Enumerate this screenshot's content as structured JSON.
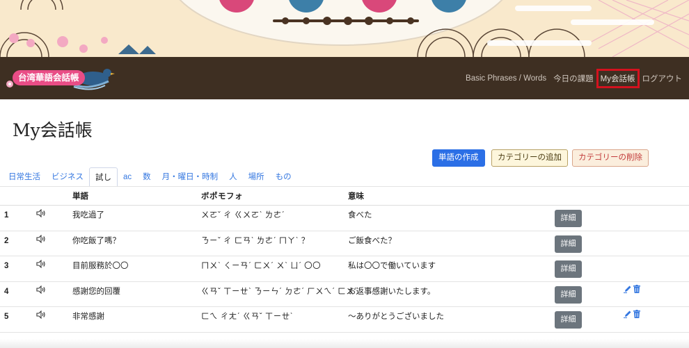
{
  "nav": {
    "logo_text": "台湾華語会話帳",
    "links": [
      {
        "label": "Basic Phrases / Words"
      },
      {
        "label": "今日の課題"
      },
      {
        "label": "My会話帳"
      },
      {
        "label": "ログアウト"
      }
    ]
  },
  "page": {
    "title": "My会話帳"
  },
  "actions": {
    "create_word": "単語の作成",
    "add_category": "カテゴリーの追加",
    "delete_category": "カテゴリーの削除"
  },
  "tabs": [
    {
      "label": "日常生活"
    },
    {
      "label": "ビジネス"
    },
    {
      "label": "試し"
    },
    {
      "label": "ac"
    },
    {
      "label": "数"
    },
    {
      "label": "月・曜日・時制"
    },
    {
      "label": "人"
    },
    {
      "label": "場所"
    },
    {
      "label": "もの"
    }
  ],
  "active_tab": "試し",
  "table": {
    "headers": {
      "word": "単語",
      "bopomofo": "ボポモフォ",
      "meaning": "意味"
    },
    "detail_label": "詳細",
    "rows": [
      {
        "num": "1",
        "word": "我吃過了",
        "bopomofo": "ㄨㄛˇ ㄔ ㄍㄨㄛˋ ㄌㄜˊ",
        "meaning": "食べた"
      },
      {
        "num": "2",
        "word": "你吃飯了嗎？",
        "bopomofo": "ㄋㄧˇ ㄔ ㄈㄢˋ ㄌㄜˊ ㄇㄚˋ ？",
        "meaning": "ご飯食べた？"
      },
      {
        "num": "3",
        "word": "目前服務於〇〇",
        "bopomofo": "ㄇㄨˋ ㄑㄧㄢˊ ㄈㄨˊ ㄨˋ ㄩˊ 〇〇",
        "meaning": "私は〇〇で働いています"
      },
      {
        "num": "4",
        "word": "感謝您的回覆",
        "bopomofo": "ㄍㄢˇ ㄒㄧㄝˋ ㄋㄧㄣˊ ㄉㄜˊ ㄏㄨㄟˊ ㄈㄨˋ",
        "meaning": "お返事感謝いたします。"
      },
      {
        "num": "5",
        "word": "非常感謝",
        "bopomofo": "ㄈㄟ ㄔㄤˊ ㄍㄢˇ ㄒㄧㄝˋ",
        "meaning": "〜ありがとうございました"
      }
    ]
  },
  "colors": {
    "navbar": "#3e2f22",
    "link": "#3477e0",
    "primary": "#2b6fe6",
    "secondary": "#6c757d",
    "highlight": "#d4121e",
    "banner": "#f9e9cc"
  }
}
